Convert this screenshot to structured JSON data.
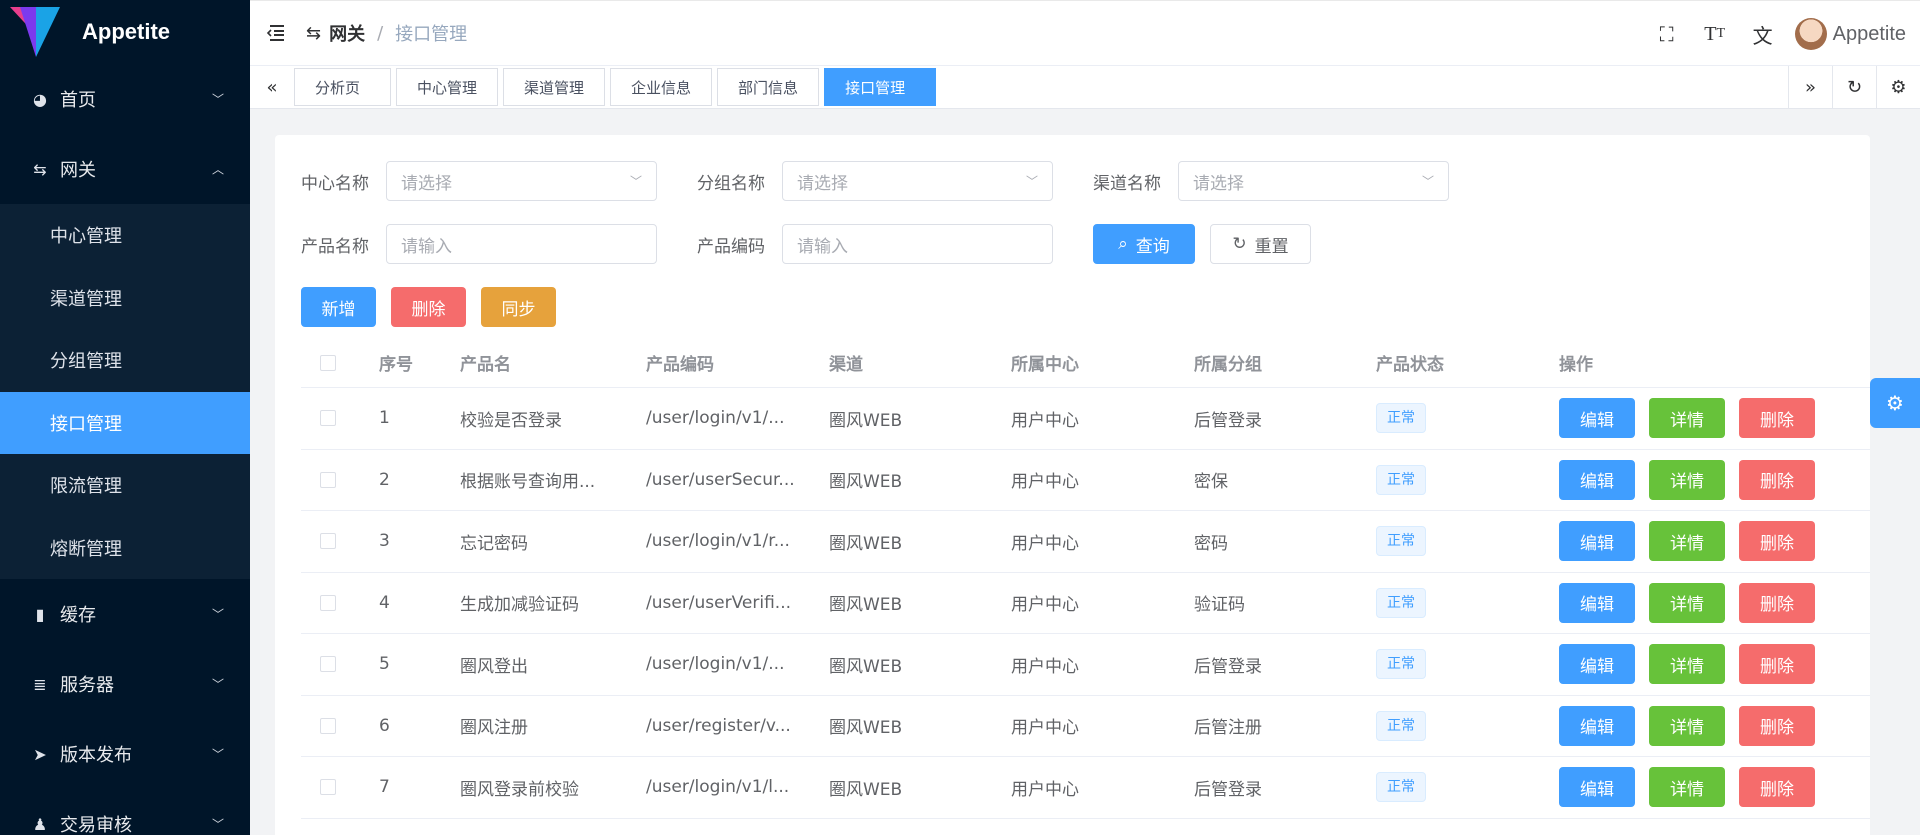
{
  "app": {
    "title": "Appetite"
  },
  "sidebar": {
    "items": [
      {
        "label": "首页",
        "icon": "dashboard-icon",
        "expanded": false
      },
      {
        "label": "网关",
        "icon": "gateway-icon",
        "expanded": true
      },
      {
        "label": "缓存",
        "icon": "cache-icon",
        "expanded": false
      },
      {
        "label": "服务器",
        "icon": "server-icon",
        "expanded": false
      },
      {
        "label": "版本发布",
        "icon": "release-icon",
        "expanded": false
      },
      {
        "label": "交易审核",
        "icon": "audit-icon",
        "expanded": false
      }
    ],
    "gateway_sub": [
      "中心管理",
      "渠道管理",
      "分组管理",
      "接口管理",
      "限流管理",
      "熔断管理"
    ],
    "active_sub": "接口管理"
  },
  "header": {
    "breadcrumb": [
      "网关",
      "接口管理"
    ],
    "separator": "/",
    "username": "Appetite"
  },
  "tabs": [
    "分析页",
    "中心管理",
    "渠道管理",
    "企业信息",
    "部门信息",
    "接口管理"
  ],
  "active_tab": "接口管理",
  "filters": {
    "center": {
      "label": "中心名称",
      "placeholder": "请选择"
    },
    "group": {
      "label": "分组名称",
      "placeholder": "请选择"
    },
    "channel": {
      "label": "渠道名称",
      "placeholder": "请选择"
    },
    "product_name": {
      "label": "产品名称",
      "placeholder": "请输入"
    },
    "product_code": {
      "label": "产品编码",
      "placeholder": "请输入"
    },
    "search": "查询",
    "reset": "重置"
  },
  "toolbar": {
    "add": "新增",
    "delete": "删除",
    "sync": "同步"
  },
  "table": {
    "headers": [
      "序号",
      "产品名",
      "产品编码",
      "渠道",
      "所属中心",
      "所属分组",
      "产品状态",
      "操作"
    ],
    "rows": [
      {
        "idx": "1",
        "name": "校验是否登录",
        "code": "/user/login/v1/...",
        "channel": "圈风WEB",
        "center": "用户中心",
        "group": "后管登录",
        "status": "正常"
      },
      {
        "idx": "2",
        "name": "根据账号查询用...",
        "code": "/user/userSecur...",
        "channel": "圈风WEB",
        "center": "用户中心",
        "group": "密保",
        "status": "正常"
      },
      {
        "idx": "3",
        "name": "忘记密码",
        "code": "/user/login/v1/r...",
        "channel": "圈风WEB",
        "center": "用户中心",
        "group": "密码",
        "status": "正常"
      },
      {
        "idx": "4",
        "name": "生成加减验证码",
        "code": "/user/userVerifi...",
        "channel": "圈风WEB",
        "center": "用户中心",
        "group": "验证码",
        "status": "正常"
      },
      {
        "idx": "5",
        "name": "圈风登出",
        "code": "/user/login/v1/...",
        "channel": "圈风WEB",
        "center": "用户中心",
        "group": "后管登录",
        "status": "正常"
      },
      {
        "idx": "6",
        "name": "圈风注册",
        "code": "/user/register/v...",
        "channel": "圈风WEB",
        "center": "用户中心",
        "group": "后管注册",
        "status": "正常"
      },
      {
        "idx": "7",
        "name": "圈风登录前校验",
        "code": "/user/login/v1/l...",
        "channel": "圈风WEB",
        "center": "用户中心",
        "group": "后管登录",
        "status": "正常"
      }
    ],
    "ops": {
      "edit": "编辑",
      "detail": "详情",
      "delete": "删除"
    }
  },
  "colors": {
    "primary": "#409eff",
    "danger": "#f56c6c",
    "warning": "#e6a23c",
    "success": "#67c23a",
    "sidebar": "#001529"
  }
}
